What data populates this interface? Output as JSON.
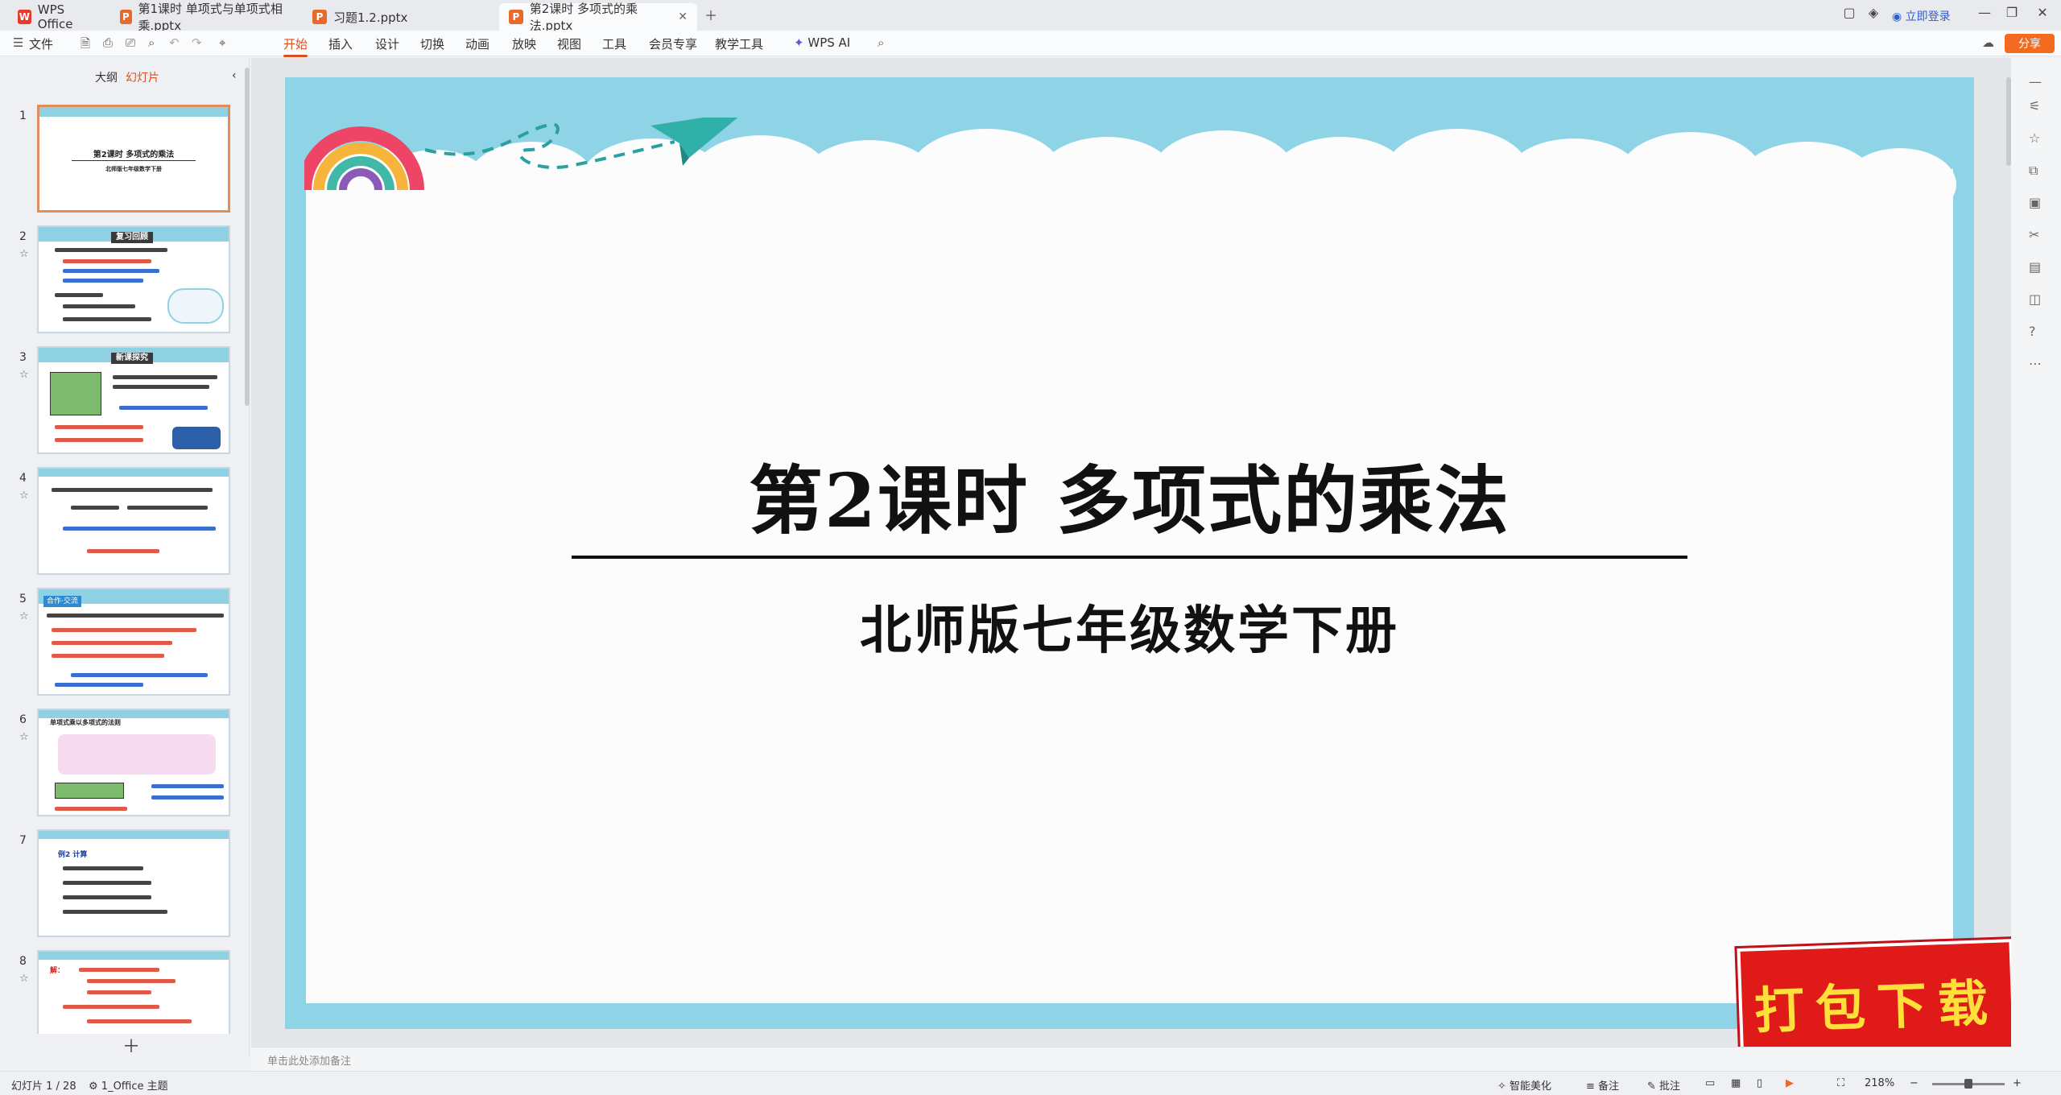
{
  "app": {
    "brand": "WPS Office",
    "login": "立即登录",
    "share": "分享"
  },
  "tabs": [
    {
      "label": "WPS Office"
    },
    {
      "label": "第1课时 单项式与单项式相乘.pptx"
    },
    {
      "label": "习题1.2.pptx"
    },
    {
      "label": "第2课时 多项式的乘法.pptx"
    }
  ],
  "menu": {
    "file": "文件",
    "items": [
      "开始",
      "插入",
      "设计",
      "切换",
      "动画",
      "放映",
      "视图",
      "工具",
      "会员专享",
      "教学工具"
    ],
    "ai": "WPS AI"
  },
  "panel": {
    "outline": "大纲",
    "slides": "幻灯片",
    "thumbs": [
      {
        "num": "1",
        "title": "第2课时  多项式的乘法",
        "sub": "北师版七年级数学下册"
      },
      {
        "num": "2",
        "title": "复习回顾"
      },
      {
        "num": "3",
        "title": "新课探究"
      },
      {
        "num": "4"
      },
      {
        "num": "5",
        "title": "合作·交流"
      },
      {
        "num": "6",
        "title": "单项式乘以多项式的法则"
      },
      {
        "num": "7",
        "title": "例2  计算"
      },
      {
        "num": "8",
        "title": "解："
      }
    ]
  },
  "slide": {
    "title": "第2课时  多项式的乘法",
    "subtitle": "北师版七年级数学下册",
    "watermark": "打包下载"
  },
  "notes_placeholder": "单击此处添加备注",
  "status": {
    "slide_count": "幻灯片 1 / 28",
    "theme": "1_Office 主题",
    "beautify": "智能美化",
    "notes": "备注",
    "comments": "批注",
    "zoom": "218%"
  },
  "colors": {
    "accent": "#d9501e",
    "sky": "#8fd3e6",
    "badge_red": "#e01919"
  }
}
